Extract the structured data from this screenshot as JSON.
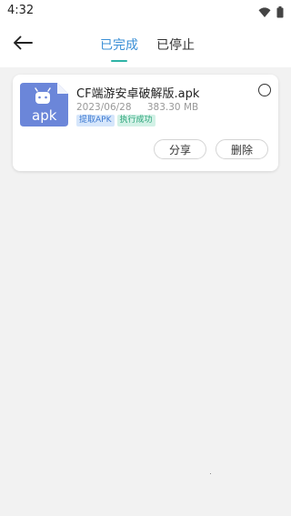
{
  "status_bar": {
    "time": "4:32"
  },
  "header": {
    "tabs": [
      {
        "label": "已完成",
        "active": true
      },
      {
        "label": "已停止",
        "active": false
      }
    ]
  },
  "downloads": [
    {
      "icon_label": "apk",
      "file_name": "CF端游安卓破解版.apk",
      "date": "2023/06/28",
      "size": "383.30 MB",
      "tags": [
        "提取APK",
        "执行成功"
      ],
      "share_label": "分享",
      "delete_label": "删除"
    }
  ],
  "colors": {
    "accent_blue": "#3a8fd6",
    "underline_teal": "#2fb3a6",
    "apk_icon_blue": "#6b86d9"
  }
}
